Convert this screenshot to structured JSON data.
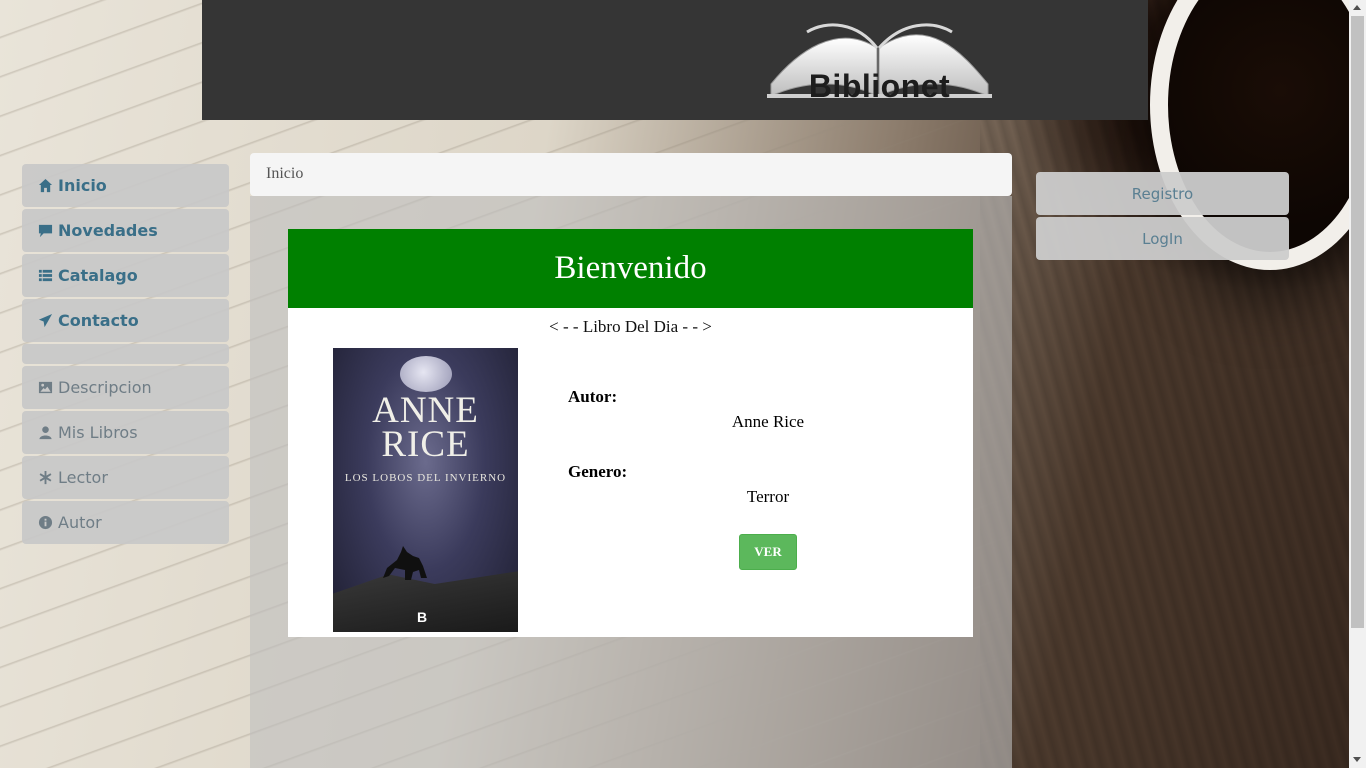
{
  "header": {
    "logo_text": "Biblionet"
  },
  "sidebar": {
    "items": [
      {
        "label": "Inicio",
        "icon": "home-icon"
      },
      {
        "label": "Novedades",
        "icon": "comment-icon"
      },
      {
        "label": "Catalago",
        "icon": "list-icon"
      },
      {
        "label": "Contacto",
        "icon": "send-icon"
      },
      {
        "label": "Descripcion",
        "icon": "picture-icon"
      },
      {
        "label": "Mis Libros",
        "icon": "user-icon"
      },
      {
        "label": "Lector",
        "icon": "asterisk-icon"
      },
      {
        "label": "Autor",
        "icon": "info-icon"
      }
    ]
  },
  "breadcrumb": {
    "current": "Inicio"
  },
  "welcome": {
    "title": "Bienvenido",
    "subtitle": "< - - Libro Del Dia - - >"
  },
  "book": {
    "cover_author": "ANNE RICE",
    "cover_author_line1": "ANNE",
    "cover_author_line2": "RICE",
    "cover_title": "LOS LOBOS DEL INVIERNO",
    "cover_publisher": "B",
    "autor_label": "Autor:",
    "autor_value": "Anne Rice",
    "genero_label": "Genero:",
    "genero_value": "Terror",
    "view_button": "VER"
  },
  "auth": {
    "register": "Registro",
    "login": "LogIn"
  },
  "colors": {
    "header_bg": "#353535",
    "welcome_bg": "#008000",
    "ver_button": "#5cb85c",
    "sidebar_text": "#4f7e95"
  }
}
